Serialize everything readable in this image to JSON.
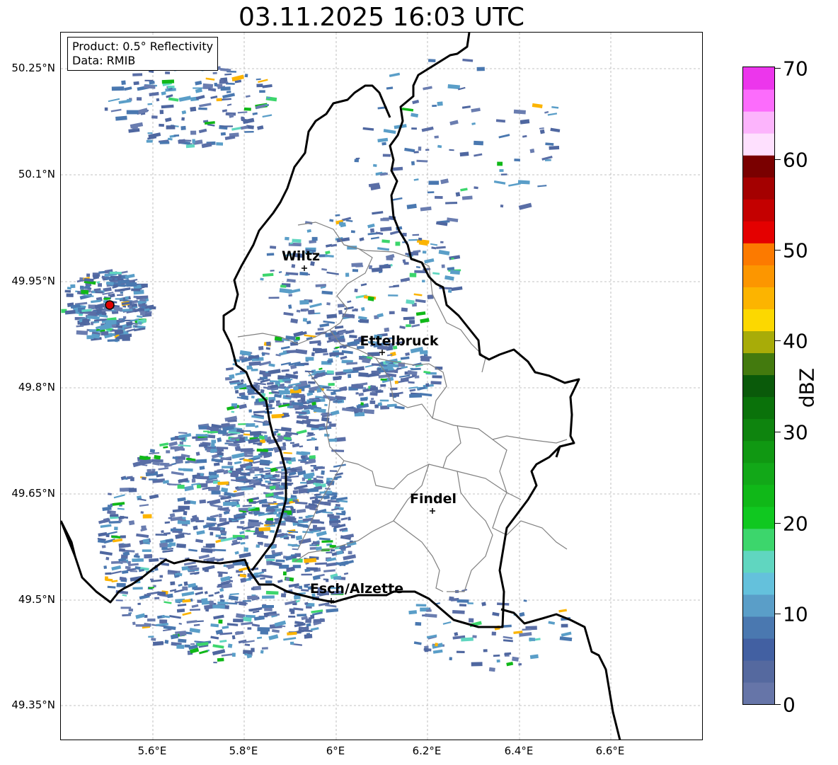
{
  "title": "03.11.2025 16:03 UTC",
  "info": {
    "product": "Product: 0.5° Reflectivity",
    "data": "Data: RMIB"
  },
  "lat_ticks": [
    "50.25°N",
    "50.1°N",
    "49.95°N",
    "49.8°N",
    "49.65°N",
    "49.5°N",
    "49.35°N"
  ],
  "lon_ticks": [
    "5.6°E",
    "5.8°E",
    "6°E",
    "6.2°E",
    "6.4°E",
    "6.6°E"
  ],
  "colorbar": {
    "label": "dBZ",
    "ticks": [
      "0",
      "10",
      "20",
      "30",
      "40",
      "50",
      "60",
      "70"
    ],
    "colors": [
      "#6675a8",
      "#55699f",
      "#4260a2",
      "#4a78b0",
      "#5a9ec8",
      "#64c1dc",
      "#60d6c0",
      "#3cd66c",
      "#10c820",
      "#10b818",
      "#12a818",
      "#109812",
      "#0e840e",
      "#0a720a",
      "#0a5a0a",
      "#437a0e",
      "#a8ac08",
      "#fcd800",
      "#fcb400",
      "#fc9600",
      "#fc7a00",
      "#e40000",
      "#c40000",
      "#a40000",
      "#7a0000",
      "#fee0fe",
      "#fcb4fc",
      "#fc6cfc",
      "#ec36ec"
    ]
  },
  "cities": [
    {
      "name": "Wiltz"
    },
    {
      "name": "Ettelbruck"
    },
    {
      "name": "Findel"
    },
    {
      "name": "Esch/Alzette"
    }
  ],
  "radar_site": {
    "color": "#e00000"
  }
}
